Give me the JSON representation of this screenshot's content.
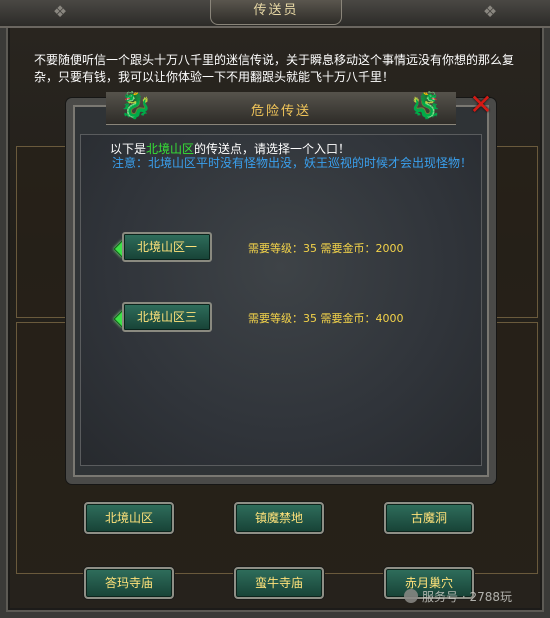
{
  "window": {
    "title": "传送员"
  },
  "intro_text": "不要随便听信一个跟头十万八千里的迷信传说，关于瞬息移动这个事情远没有你想的那么复杂，只要有钱，我可以让你体验一下不用翻跟头就能飞十万八千里！",
  "dialog": {
    "title": "危险传送",
    "line1_prefix": "以下是",
    "line1_highlight": "北境山区",
    "line1_suffix": "的传送点，请选择一个入口！",
    "line2": "注意：北境山区平时没有怪物出没，妖王巡视的时候才会出现怪物！",
    "portals": [
      {
        "label": "北境山区一",
        "info": "需要等级：35  需要金币：2000"
      },
      {
        "label": "北境山区三",
        "info": "需要等级：35  需要金币：4000"
      }
    ]
  },
  "buttons": [
    {
      "label": "北境山区"
    },
    {
      "label": "镇魔禁地"
    },
    {
      "label": "古魔洞"
    },
    {
      "label": "答玛寺庙"
    },
    {
      "label": "蛮牛寺庙"
    },
    {
      "label": "赤月巢穴"
    }
  ],
  "watermark": {
    "text": "服务号 · 2788玩"
  },
  "icons": {
    "close": "close-x-icon",
    "portal_marker": "green-diamond-icon",
    "dragon": "dragon-ornament-icon"
  },
  "colors": {
    "title_gold": "#f2c65a",
    "highlight_green": "#36e236",
    "note_blue": "#3aa0ee",
    "info_yellow": "#f3d34a",
    "button_text": "#ffe27a",
    "close_red": "#d41a14"
  }
}
